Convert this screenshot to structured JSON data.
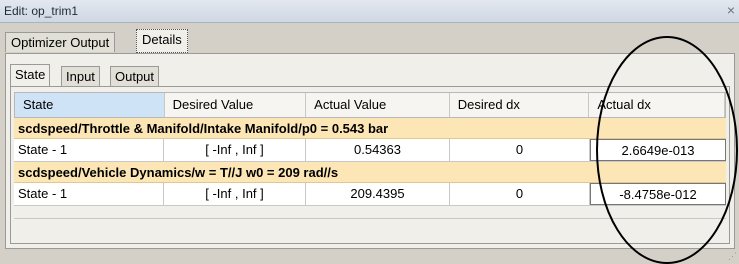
{
  "window": {
    "title": "Edit: op_trim1",
    "close_glyph": "×"
  },
  "outer_tabs": [
    "Optimizer Output",
    "Details"
  ],
  "inner_tabs": [
    "State",
    "Input",
    "Output"
  ],
  "columns": [
    "State",
    "Desired Value",
    "Actual Value",
    "Desired dx",
    "Actual dx"
  ],
  "groups": [
    {
      "label": "scdspeed/Throttle & Manifold/Intake Manifold/p0 = 0.543 bar",
      "row": {
        "state": "State - 1",
        "desired_value": "[ -Inf , Inf ]",
        "actual_value": "0.54363",
        "desired_dx": "0",
        "actual_dx": "2.6649e-013"
      }
    },
    {
      "label": "scdspeed/Vehicle Dynamics/w = T//J w0 = 209 rad//s",
      "row": {
        "state": "State - 1",
        "desired_value": "[ -Inf , Inf ]",
        "actual_value": "209.4395",
        "desired_dx": "0",
        "actual_dx": "-8.4758e-012"
      }
    }
  ],
  "colors": {
    "group_header": "#fde6b5",
    "selected_header": "#cfe3f7",
    "annotation": "#000000"
  }
}
